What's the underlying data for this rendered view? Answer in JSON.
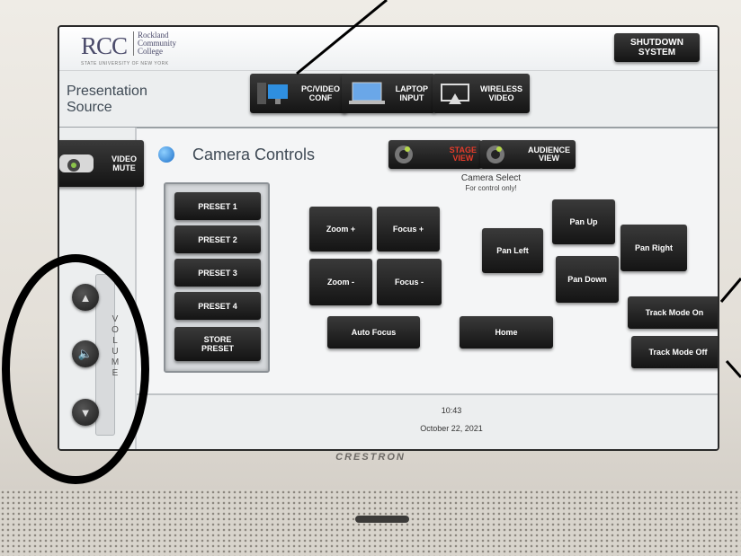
{
  "device": {
    "brand": "CRESTRON"
  },
  "header": {
    "logo_rcc": "RCC",
    "logo_name": "Rockland\nCommunity\nCollege",
    "logo_sub": "STATE UNIVERSITY OF NEW YORK",
    "shutdown_label": "SHUTDOWN\nSYSTEM"
  },
  "source": {
    "label": "Presentation\nSource",
    "buttons": [
      {
        "label": "PC/VIDEO\nCONF",
        "icon": "pc-icon"
      },
      {
        "label": "LAPTOP\nINPUT",
        "icon": "laptop-icon"
      },
      {
        "label": "WIRELESS\nVIDEO",
        "icon": "airplay-icon"
      }
    ]
  },
  "left": {
    "video_mute": "VIDEO\nMUTE"
  },
  "camera": {
    "title": "Camera Controls",
    "stage_view": "STAGE\nVIEW",
    "audience_view": "AUDIENCE\nVIEW",
    "select_label": "Camera Select",
    "select_sub": "For control only!",
    "presets": [
      "PRESET 1",
      "PRESET 2",
      "PRESET 3",
      "PRESET 4",
      "STORE\nPRESET"
    ],
    "zoom_plus": "Zoom +",
    "zoom_minus": "Zoom -",
    "focus_plus": "Focus +",
    "focus_minus": "Focus -",
    "auto_focus": "Auto Focus",
    "home": "Home",
    "pan_up": "Pan Up",
    "pan_down": "Pan Down",
    "pan_left": "Pan Left",
    "pan_right": "Pan Right",
    "track_on": "Track Mode On",
    "track_off": "Track Mode Off"
  },
  "volume": {
    "label": "V\nO\nL\nU\nM\nE"
  },
  "status": {
    "time": "10:43",
    "date": "October 22, 2021"
  },
  "colors": {
    "stage_view_text": "#e53b2a",
    "accent": "#1c6fc9"
  }
}
